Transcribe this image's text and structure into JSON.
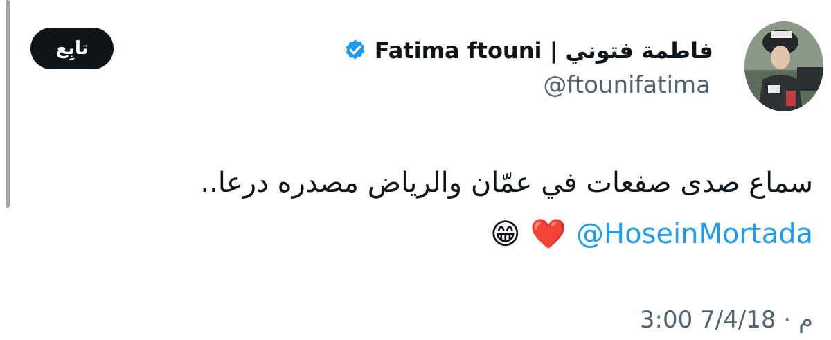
{
  "author": {
    "display_name": "فاطمة فتوني | Fatima ftouni",
    "handle": "@ftounifatima",
    "verified": true
  },
  "follow_label": "تابِع",
  "tweet": {
    "text": "سماع صدى صفعات في عمّان والرياض مصدره درعا..",
    "mention": "@HoseinMortada",
    "emojis": [
      "❤️",
      "😁"
    ]
  },
  "timestamp": "3:00 م · 7/4/18",
  "colors": {
    "link": "#1d9bf0",
    "muted": "#536471",
    "text": "#0f1419",
    "verified": "#1d9bf0",
    "button_bg": "#0f1419"
  },
  "icons": {
    "verified": "verified-badge-icon",
    "avatar": "profile-photo"
  }
}
